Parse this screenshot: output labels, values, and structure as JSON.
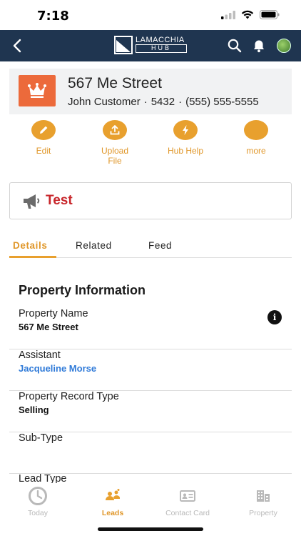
{
  "status_bar": {
    "time": "7:18"
  },
  "header": {
    "logo_top": "LAMACCHIA",
    "logo_bottom": "HUB"
  },
  "record": {
    "title": "567 Me Street",
    "contact": "John Customer",
    "number": "5432",
    "phone": "(555) 555-5555",
    "icon": "crown-icon",
    "icon_color": "#ec6a3b"
  },
  "actions": [
    {
      "label": "Edit",
      "icon": "pencil-icon"
    },
    {
      "label": "Upload File",
      "icon": "upload-icon"
    },
    {
      "label": "Hub Help",
      "icon": "lightning-icon"
    },
    {
      "label": "more",
      "icon": "more-icon"
    }
  ],
  "alert": {
    "text": "Test",
    "icon": "megaphone-icon",
    "color": "#c8262b"
  },
  "tabs": [
    {
      "label": "Details",
      "active": true
    },
    {
      "label": "Related",
      "active": false
    },
    {
      "label": "Feed",
      "active": false
    }
  ],
  "section": {
    "title": "Property Information"
  },
  "fields": [
    {
      "label": "Property Name",
      "value": "567 Me Street"
    },
    {
      "label": "Assistant",
      "value": "Jacqueline Morse"
    },
    {
      "label": "Property Record Type",
      "value": "Selling"
    },
    {
      "label": "Sub-Type",
      "value": ""
    },
    {
      "label": "Lead Type",
      "value": ""
    }
  ],
  "tabbar": [
    {
      "label": "Today",
      "icon": "clock-icon",
      "active": false
    },
    {
      "label": "Leads",
      "icon": "leads-icon",
      "active": true
    },
    {
      "label": "Contact Card",
      "icon": "contact-card-icon",
      "active": false
    },
    {
      "label": "Property",
      "icon": "building-icon",
      "active": false
    }
  ],
  "colors": {
    "accent": "#e8a02e",
    "header_bg": "#1f3550",
    "link": "#2f7ad8"
  }
}
